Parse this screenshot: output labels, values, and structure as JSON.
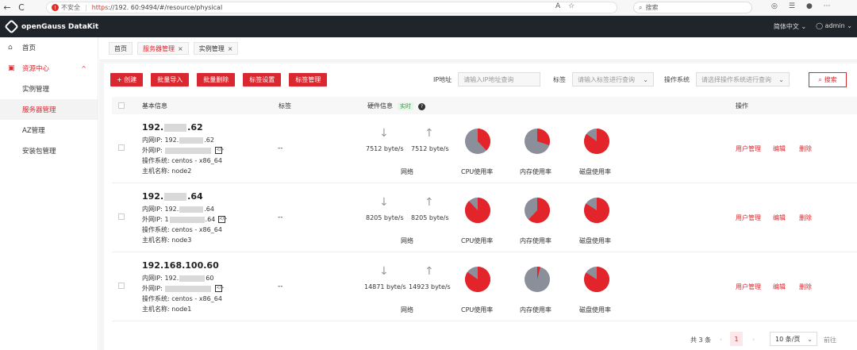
{
  "browser": {
    "back": "←",
    "refresh": "C",
    "not_secure": "不安全",
    "https": "https",
    "url": "://192.          60:9494/#/resource/physical",
    "search_placeholder": "搜索"
  },
  "app": {
    "title": "openGauss DataKit",
    "language": "简体中文",
    "user": "admin"
  },
  "sidebar": {
    "home": "首页",
    "resource_center": "资源中心",
    "items": [
      "实例管理",
      "服务器管理",
      "AZ管理",
      "安装包管理"
    ]
  },
  "tabs": [
    {
      "label": "首页"
    },
    {
      "label": "服务器管理"
    },
    {
      "label": "实例管理"
    }
  ],
  "toolbar": {
    "create": "+ 创建",
    "batch_import": "批量导入",
    "batch_delete": "批量删除",
    "tag_settings": "标签设置",
    "tag_manage": "标签管理"
  },
  "filters": {
    "ip_label": "IP地址",
    "ip_placeholder": "请输入IP地址查询",
    "tag_label": "标签",
    "tag_placeholder": "请输入标签进行查询",
    "os_label": "操作系统",
    "os_placeholder": "请选择操作系统进行查询",
    "search": "搜索"
  },
  "table": {
    "headers": {
      "basic": "基本信息",
      "tag": "标签",
      "hardware": "硬件信息",
      "realtime": "实时",
      "action": "操作"
    },
    "labels": {
      "inner_ip": "内网IP:",
      "outer_ip": "外网IP:",
      "os": "操作系统:",
      "hostname": "主机名称:",
      "network": "网络",
      "cpu": "CPU使用率",
      "mem": "内存使用率",
      "disk": "磁盘使用率",
      "user_mgmt": "用户管理",
      "edit": "编辑",
      "delete": "删除"
    },
    "rows": [
      {
        "title_a": "192.",
        "title_b": ".62",
        "inner_a": "192.",
        "inner_b": ".62",
        "os": "centos - x86_64",
        "hostname": "node2",
        "tag": "--",
        "down": "7512 byte/s",
        "up": "7512 byte/s",
        "cpu": 0.38,
        "mem": 0.3,
        "disk": 0.85
      },
      {
        "title_a": "192.",
        "title_b": ".64",
        "inner_a": "192.",
        "inner_b": ".64",
        "outer_prefix": "1",
        "outer_suffix": ".64",
        "os": "centos - x86_64",
        "hostname": "node3",
        "tag": "--",
        "down": "8205 byte/s",
        "up": "8205 byte/s",
        "cpu": 0.88,
        "mem": 0.62,
        "disk": 0.84
      },
      {
        "title": "192.168.100.60",
        "inner_a": "192.",
        "inner_b": "60",
        "os": "centos - x86_64",
        "hostname": "node1",
        "tag": "--",
        "down": "14871 byte/s",
        "up": "14923 byte/s",
        "cpu": 0.85,
        "mem": 0.04,
        "disk": 0.84
      }
    ]
  },
  "pager": {
    "total": "共 3 条",
    "page": "1",
    "size": "10 条/页",
    "goto": "前往"
  },
  "colors": {
    "accent": "#d9282f",
    "pie_used": "#e3242b",
    "pie_free": "#8a8f99"
  }
}
